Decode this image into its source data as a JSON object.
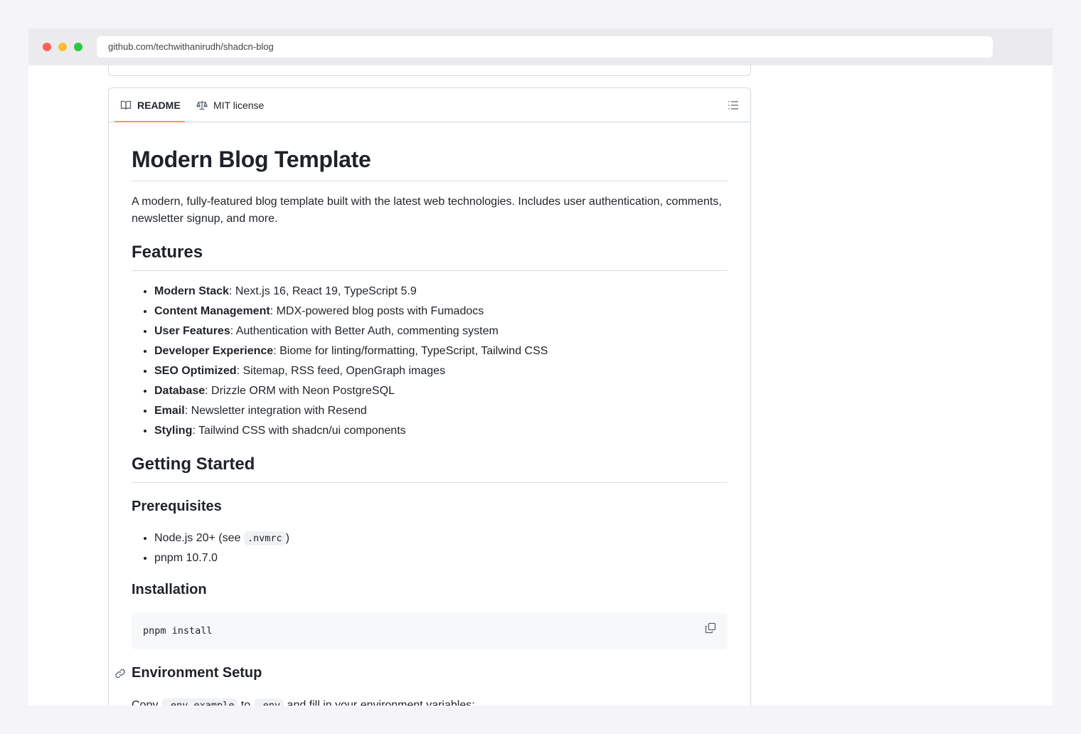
{
  "browser": {
    "url": "github.com/techwithanirudh/shadcn-blog"
  },
  "tabs": {
    "readme": "README",
    "license": "MIT license"
  },
  "readme": {
    "title": "Modern Blog Template",
    "intro": "A modern, fully-featured blog template built with the latest web technologies. Includes user authentication, comments, newsletter signup, and more.",
    "features_heading": "Features",
    "features": [
      {
        "label": "Modern Stack",
        "text": ": Next.js 16, React 19, TypeScript 5.9"
      },
      {
        "label": "Content Management",
        "text": ": MDX-powered blog posts with Fumadocs"
      },
      {
        "label": "User Features",
        "text": ": Authentication with Better Auth, commenting system"
      },
      {
        "label": "Developer Experience",
        "text": ": Biome for linting/formatting, TypeScript, Tailwind CSS"
      },
      {
        "label": "SEO Optimized",
        "text": ": Sitemap, RSS feed, OpenGraph images"
      },
      {
        "label": "Database",
        "text": ": Drizzle ORM with Neon PostgreSQL"
      },
      {
        "label": "Email",
        "text": ": Newsletter integration with Resend"
      },
      {
        "label": "Styling",
        "text": ": Tailwind CSS with shadcn/ui components"
      }
    ],
    "getting_started_heading": "Getting Started",
    "prerequisites_heading": "Prerequisites",
    "prereq_node_prefix": "Node.js 20+ (see ",
    "prereq_node_code": ".nvmrc",
    "prereq_node_suffix": ")",
    "prereq_pnpm": "pnpm 10.7.0",
    "installation_heading": "Installation",
    "install_command": "pnpm install",
    "env_heading": "Environment Setup",
    "env_copy_prefix": "Copy ",
    "env_copy_code1": ".env.example",
    "env_copy_mid": " to ",
    "env_copy_code2": ".env",
    "env_copy_suffix": " and fill in your environment variables:"
  }
}
